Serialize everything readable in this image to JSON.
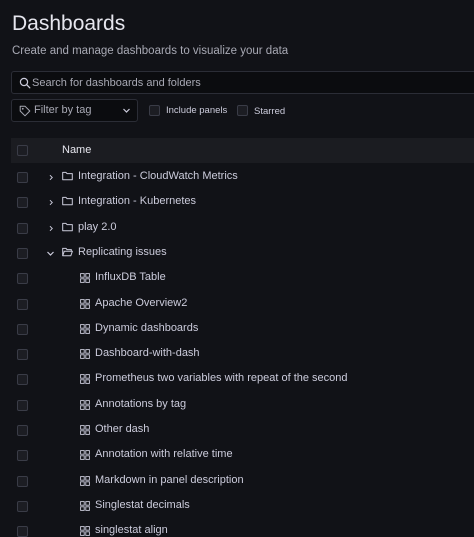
{
  "page": {
    "title": "Dashboards",
    "subtitle": "Create and manage dashboards to visualize your data"
  },
  "search": {
    "placeholder": "Search for dashboards and folders"
  },
  "filters": {
    "tag_placeholder": "Filter by tag",
    "include_panels_label": "Include panels",
    "starred_label": "Starred"
  },
  "table": {
    "column_name": "Name"
  },
  "rows": [
    {
      "type": "folder",
      "expanded": false,
      "label": "Integration - CloudWatch Metrics"
    },
    {
      "type": "folder",
      "expanded": false,
      "label": "Integration - Kubernetes"
    },
    {
      "type": "folder",
      "expanded": false,
      "label": "play 2.0"
    },
    {
      "type": "folder",
      "expanded": true,
      "label": "Replicating issues"
    },
    {
      "type": "dashboard",
      "label": "InfluxDB Table"
    },
    {
      "type": "dashboard",
      "label": "Apache Overview2"
    },
    {
      "type": "dashboard",
      "label": "Dynamic dashboards"
    },
    {
      "type": "dashboard",
      "label": "Dashboard-with-dash"
    },
    {
      "type": "dashboard",
      "label": "Prometheus two variables with repeat of the second"
    },
    {
      "type": "dashboard",
      "label": "Annotations by tag"
    },
    {
      "type": "dashboard",
      "label": "Other dash"
    },
    {
      "type": "dashboard",
      "label": "Annotation with relative time"
    },
    {
      "type": "dashboard",
      "label": "Markdown in panel description"
    },
    {
      "type": "dashboard",
      "label": "Singlestat decimals"
    },
    {
      "type": "dashboard",
      "label": "singlestat align"
    }
  ]
}
